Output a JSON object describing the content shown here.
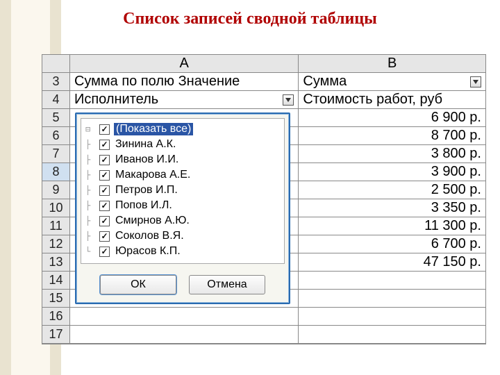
{
  "title": "Список записей сводной таблицы",
  "columns": {
    "A": "A",
    "B": "B"
  },
  "header_cells": {
    "a3": "Сумма по полю Значение",
    "b3": "Сумма",
    "a4": "Исполнитель",
    "b4": "Стоимость работ, руб"
  },
  "row_numbers": [
    "3",
    "4",
    "5",
    "6",
    "7",
    "8",
    "9",
    "10",
    "11",
    "12",
    "13",
    "14",
    "15",
    "16",
    "17"
  ],
  "values_b": [
    "6 900 р.",
    "8 700 р.",
    "3 800 р.",
    "3 900 р.",
    "2 500 р.",
    "3 350 р.",
    "11 300 р.",
    "6 700 р.",
    "47 150 р."
  ],
  "filter": {
    "items": [
      {
        "label": "(Показать все)",
        "checked": true,
        "selected": true
      },
      {
        "label": "Зинина А.К.",
        "checked": true
      },
      {
        "label": "Иванов И.И.",
        "checked": true
      },
      {
        "label": "Макарова А.Е.",
        "checked": true
      },
      {
        "label": "Петров И.П.",
        "checked": true
      },
      {
        "label": "Попов И.Л.",
        "checked": true
      },
      {
        "label": "Смирнов А.Ю.",
        "checked": true
      },
      {
        "label": "Соколов В.Я.",
        "checked": true
      },
      {
        "label": "Юрасов К.П.",
        "checked": true
      }
    ],
    "ok": "ОК",
    "cancel": "Отмена"
  },
  "chart_data": {
    "type": "table",
    "title": "Сумма по полю Значение",
    "columns": [
      "Исполнитель",
      "Стоимость работ, руб"
    ],
    "rows": [
      [
        "Зинина А.К.",
        6900
      ],
      [
        "Иванов И.И.",
        8700
      ],
      [
        "Макарова А.Е.",
        3800
      ],
      [
        "Петров И.П.",
        3900
      ],
      [
        "Попов И.Л.",
        2500
      ],
      [
        "Смирнов А.Ю.",
        3350
      ],
      [
        "Соколов В.Я.",
        11300
      ],
      [
        "Юрасов К.П.",
        6700
      ]
    ],
    "total": 47150,
    "currency": "р."
  }
}
